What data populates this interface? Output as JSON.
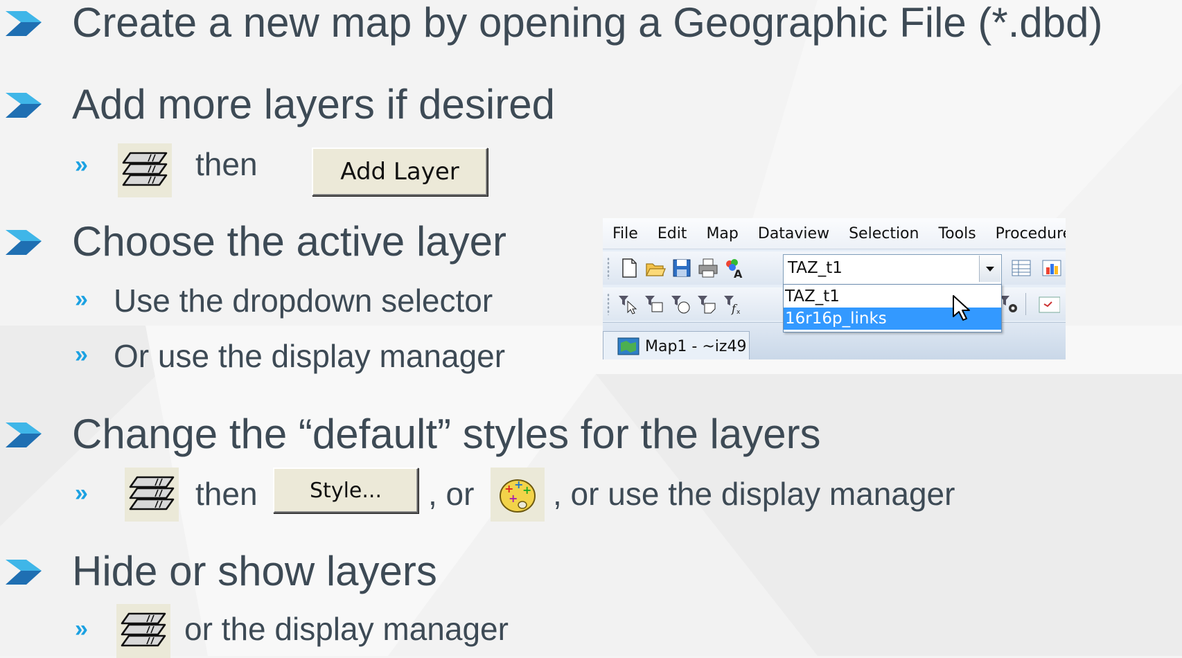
{
  "colors": {
    "background": "#f4f4f4",
    "text": "#3d4a55",
    "bullet": "#1ba1e2",
    "arrow_dark": "#1f6fb2",
    "arrow_light": "#3fb6e8",
    "selection": "#3399ff"
  },
  "bullets": [
    {
      "text": "Create a new map by opening a Geographic File (*.dbd)"
    },
    {
      "text": "Add more layers if desired",
      "sub": {
        "marker": "»",
        "icon": "layers-icon",
        "then": "then",
        "button": "Add Layer"
      }
    },
    {
      "text": "Choose the active layer",
      "subs": [
        {
          "marker": "»",
          "text": "Use the dropdown selector"
        },
        {
          "marker": "»",
          "text": "Or use the display manager"
        }
      ]
    },
    {
      "text": "Change the “default” styles for the layers",
      "sub": {
        "marker": "»",
        "icon": "layers-icon",
        "then": "then",
        "button": "Style...",
        "or": ", or",
        "style_icon": "palette-icon",
        "tail": ", or use the display manager"
      }
    },
    {
      "text": "Hide or show layers",
      "sub": {
        "marker": "»",
        "icon": "layers-icon",
        "text": "or the display manager"
      }
    }
  ],
  "app": {
    "menu": [
      "File",
      "Edit",
      "Map",
      "Dataview",
      "Selection",
      "Tools",
      "Procedure"
    ],
    "toolbar1_icons": [
      "new-file-icon",
      "open-folder-icon",
      "save-icon",
      "print-icon",
      "color-text-icon",
      "table-view-icon",
      "chart-icon"
    ],
    "toolbar2_icons": [
      "select-pointer-icon",
      "select-rect-icon",
      "select-circle-icon",
      "select-polygon-icon",
      "select-formula-icon",
      "settings-icon",
      "map-view-icon"
    ],
    "layer_combo": {
      "value": "TAZ_t1",
      "options": [
        "TAZ_t1",
        "16r16p_links"
      ],
      "highlighted": "16r16p_links"
    },
    "map_tab": {
      "icon": "map-icon",
      "label": "Map1 - ~iz49"
    }
  }
}
